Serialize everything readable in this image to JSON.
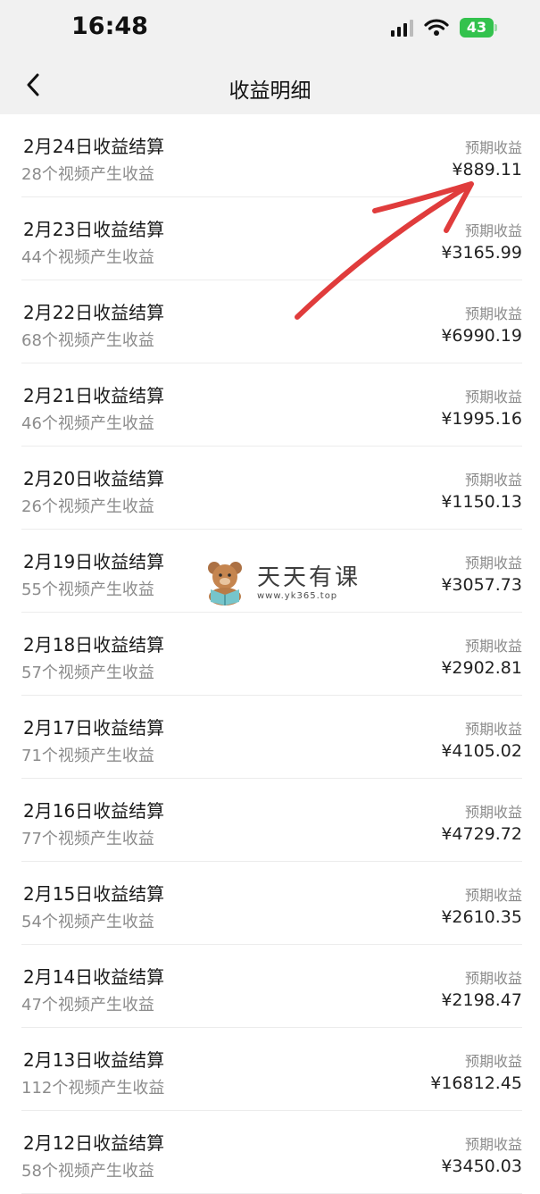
{
  "status_bar": {
    "time": "16:48",
    "battery": "43"
  },
  "header": {
    "title": "收益明细",
    "back_icon": "chevron-left-icon"
  },
  "rows": [
    {
      "title": "2月24日收益结算",
      "subtitle": "28个视频产生收益",
      "label": "预期收益",
      "amount": "¥889.11"
    },
    {
      "title": "2月23日收益结算",
      "subtitle": "44个视频产生收益",
      "label": "预期收益",
      "amount": "¥3165.99"
    },
    {
      "title": "2月22日收益结算",
      "subtitle": "68个视频产生收益",
      "label": "预期收益",
      "amount": "¥6990.19"
    },
    {
      "title": "2月21日收益结算",
      "subtitle": "46个视频产生收益",
      "label": "预期收益",
      "amount": "¥1995.16"
    },
    {
      "title": "2月20日收益结算",
      "subtitle": "26个视频产生收益",
      "label": "预期收益",
      "amount": "¥1150.13"
    },
    {
      "title": "2月19日收益结算",
      "subtitle": "55个视频产生收益",
      "label": "预期收益",
      "amount": "¥3057.73"
    },
    {
      "title": "2月18日收益结算",
      "subtitle": "57个视频产生收益",
      "label": "预期收益",
      "amount": "¥2902.81"
    },
    {
      "title": "2月17日收益结算",
      "subtitle": "71个视频产生收益",
      "label": "预期收益",
      "amount": "¥4105.02"
    },
    {
      "title": "2月16日收益结算",
      "subtitle": "77个视频产生收益",
      "label": "预期收益",
      "amount": "¥4729.72"
    },
    {
      "title": "2月15日收益结算",
      "subtitle": "54个视频产生收益",
      "label": "预期收益",
      "amount": "¥2610.35"
    },
    {
      "title": "2月14日收益结算",
      "subtitle": "47个视频产生收益",
      "label": "预期收益",
      "amount": "¥2198.47"
    },
    {
      "title": "2月13日收益结算",
      "subtitle": "112个视频产生收益",
      "label": "预期收益",
      "amount": "¥16812.45"
    },
    {
      "title": "2月12日收益结算",
      "subtitle": "58个视频产生收益",
      "label": "预期收益",
      "amount": "¥3450.03"
    }
  ],
  "watermark": {
    "title": "天天有课",
    "url": "www.yk365.top"
  },
  "colors": {
    "annotation_arrow": "#e03c3c",
    "battery": "#33c24d",
    "header_bg": "#f1f1f1"
  }
}
